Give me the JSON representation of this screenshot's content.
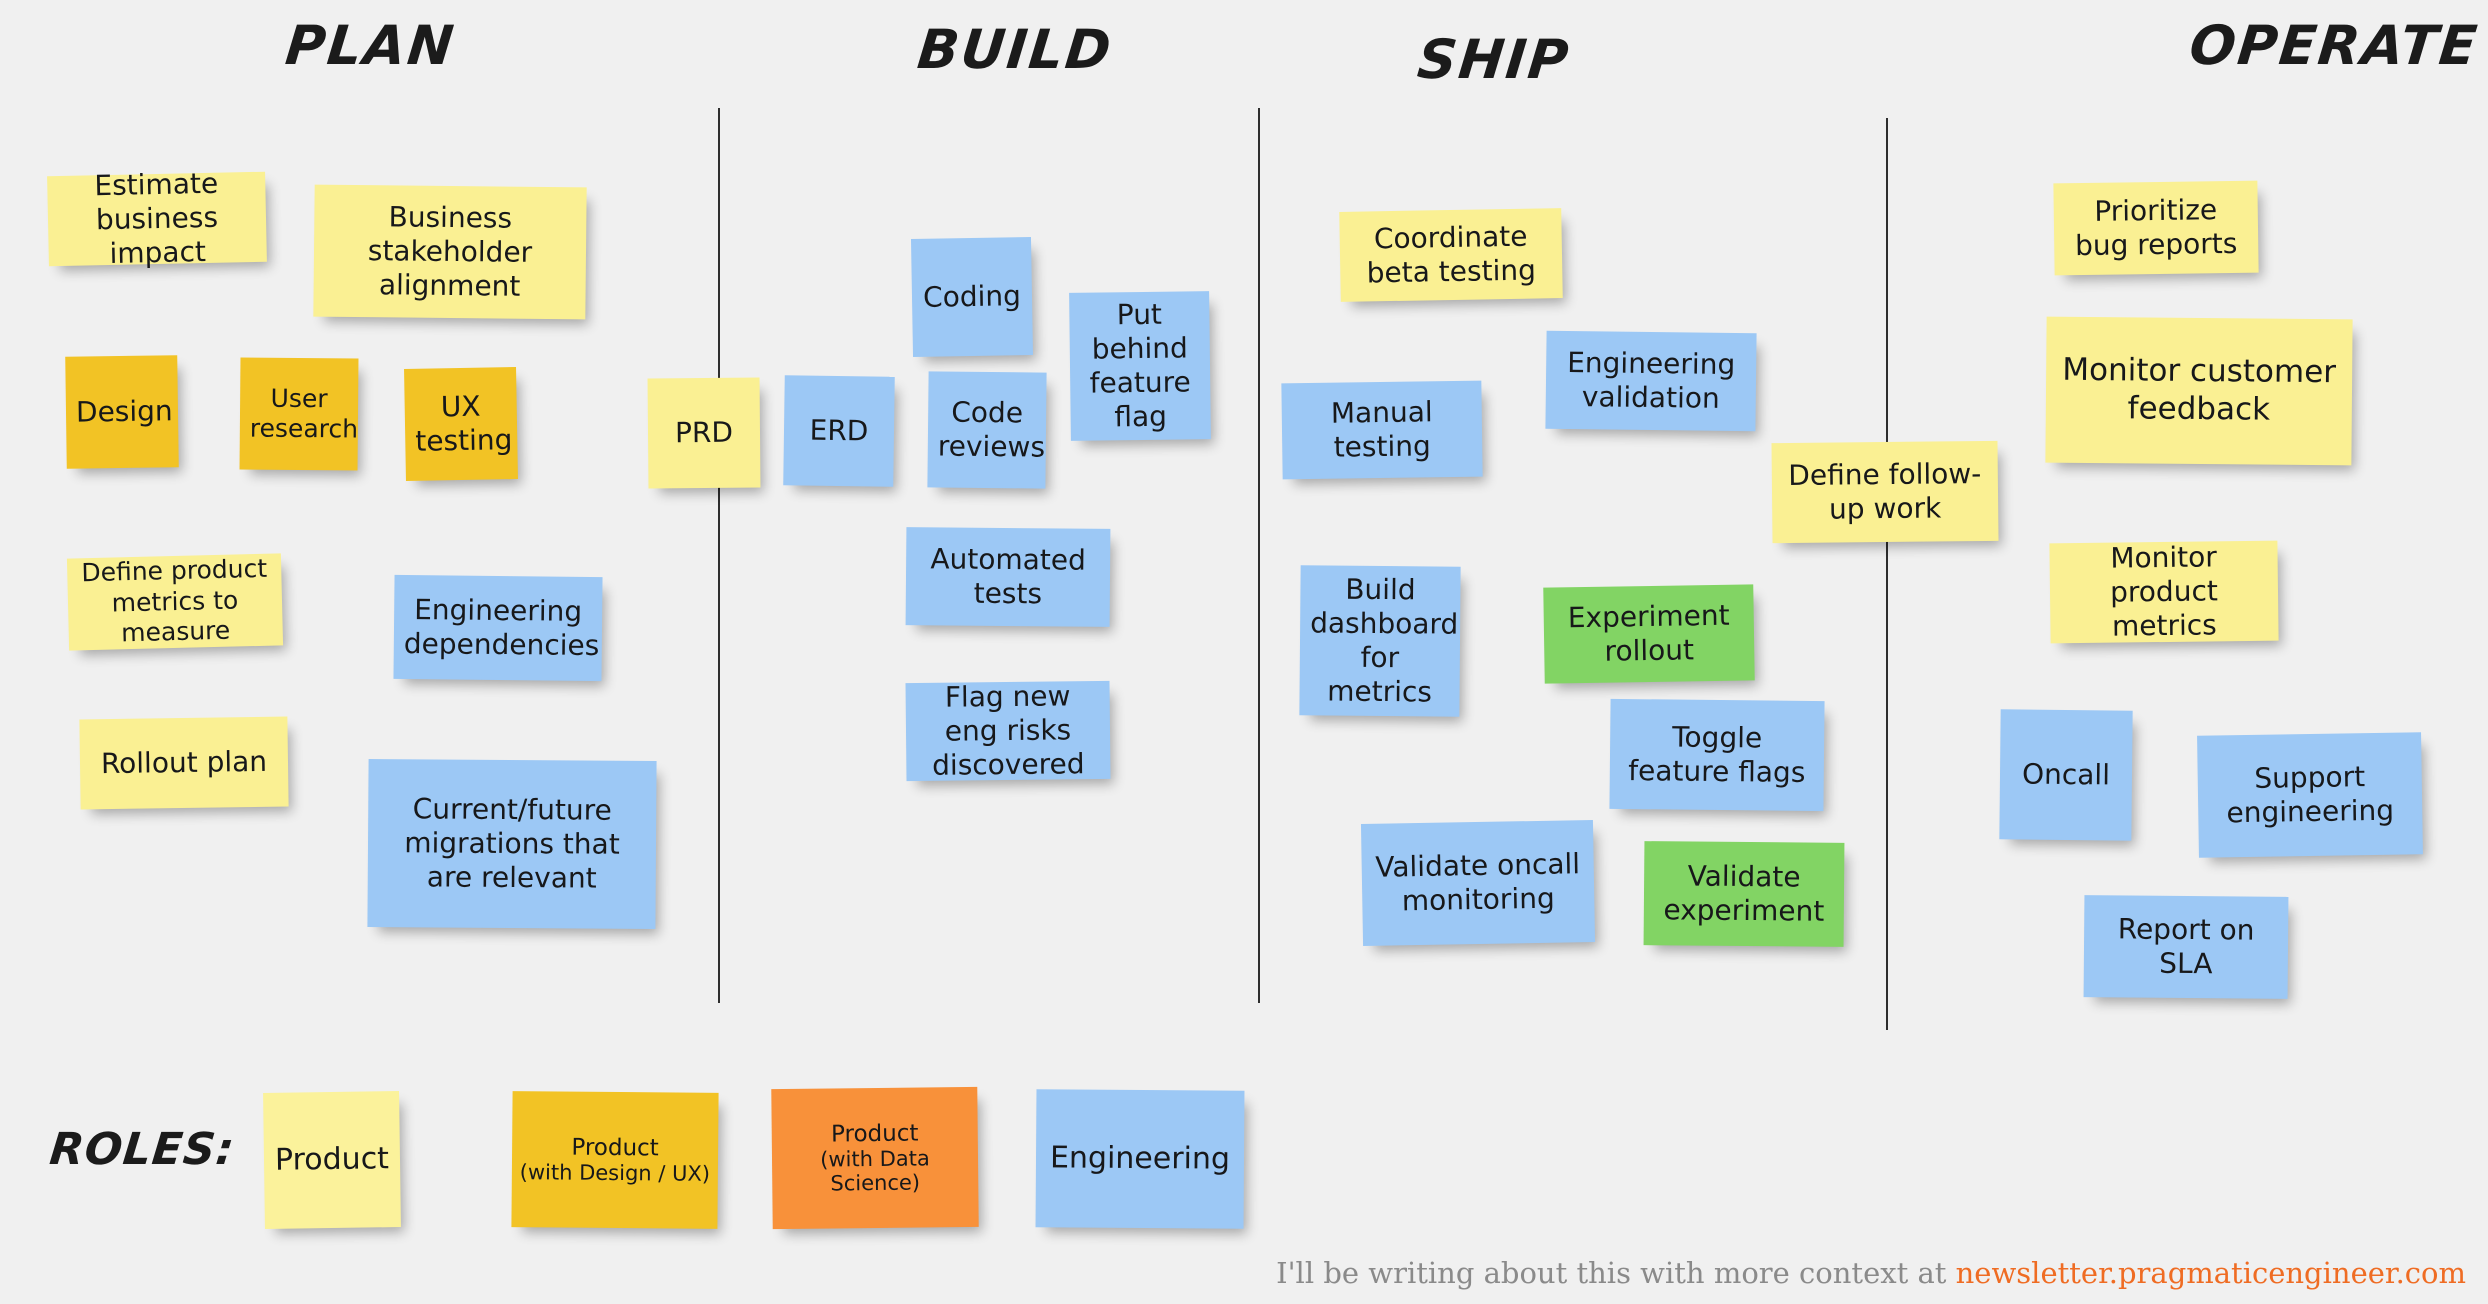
{
  "columns": [
    {
      "label": "Plan"
    },
    {
      "label": "Build"
    },
    {
      "label": "Ship"
    },
    {
      "label": "Operate"
    }
  ],
  "legend": {
    "title": "Roles:",
    "items": [
      {
        "line1": "Product",
        "line2": "",
        "color": "#fbf29b",
        "color_name": "pale-yellow"
      },
      {
        "line1": "Product",
        "line2": "(with Design / UX)",
        "color": "#f2c325",
        "color_name": "gold"
      },
      {
        "line1": "Product",
        "line2": "(with Data Science)",
        "color": "#f8913a",
        "color_name": "orange"
      },
      {
        "line1": "Engineering",
        "line2": "",
        "color": "#9cc8f5",
        "color_name": "blue"
      }
    ]
  },
  "footer": {
    "text": "I'll be writing about this with more context at ",
    "link": "newsletter.pragmaticengineer.com",
    "link_color": "#ef6c23"
  },
  "notes": [
    {
      "text": "Estimate business impact",
      "column": "Plan",
      "color": "yellow"
    },
    {
      "text": "Business stakeholder alignment",
      "column": "Plan",
      "color": "yellow"
    },
    {
      "text": "Design",
      "column": "Plan",
      "color": "gold"
    },
    {
      "text": "User research",
      "column": "Plan",
      "color": "gold"
    },
    {
      "text": "UX testing",
      "column": "Plan",
      "color": "gold"
    },
    {
      "text": "Define product metrics to measure",
      "column": "Plan",
      "color": "yellow"
    },
    {
      "text": "Engineering dependencies",
      "column": "Plan",
      "color": "blue"
    },
    {
      "text": "Rollout plan",
      "column": "Plan",
      "color": "yellow"
    },
    {
      "text": "Current/future migrations that are relevant",
      "column": "Plan",
      "color": "blue"
    },
    {
      "text": "PRD",
      "column": "Build",
      "color": "yellow"
    },
    {
      "text": "ERD",
      "column": "Build",
      "color": "blue"
    },
    {
      "text": "Coding",
      "column": "Build",
      "color": "blue"
    },
    {
      "text": "Code reviews",
      "column": "Build",
      "color": "blue"
    },
    {
      "text": "Put behind feature flag",
      "column": "Build",
      "color": "blue"
    },
    {
      "text": "Automated tests",
      "column": "Build",
      "color": "blue"
    },
    {
      "text": "Flag new eng risks discovered",
      "column": "Build",
      "color": "blue"
    },
    {
      "text": "Coordinate beta testing",
      "column": "Ship",
      "color": "yellow"
    },
    {
      "text": "Engineering validation",
      "column": "Ship",
      "color": "blue"
    },
    {
      "text": "Manual testing",
      "column": "Ship",
      "color": "blue"
    },
    {
      "text": "Build dashboard for metrics",
      "column": "Ship",
      "color": "blue"
    },
    {
      "text": "Experiment rollout",
      "column": "Ship",
      "color": "green"
    },
    {
      "text": "Toggle feature flags",
      "column": "Ship",
      "color": "blue"
    },
    {
      "text": "Validate oncall monitoring",
      "column": "Ship",
      "color": "blue"
    },
    {
      "text": "Validate experiment",
      "column": "Ship",
      "color": "green"
    },
    {
      "text": "Define follow-up work",
      "column": "Ship",
      "color": "yellow"
    },
    {
      "text": "Prioritize bug reports",
      "column": "Operate",
      "color": "yellow"
    },
    {
      "text": "Monitor customer feedback",
      "column": "Operate",
      "color": "yellow"
    },
    {
      "text": "Monitor product metrics",
      "column": "Operate",
      "color": "yellow"
    },
    {
      "text": "Oncall",
      "column": "Operate",
      "color": "blue"
    },
    {
      "text": "Support engineering",
      "column": "Operate",
      "color": "blue"
    },
    {
      "text": "Report on SLA",
      "column": "Operate",
      "color": "blue"
    }
  ]
}
